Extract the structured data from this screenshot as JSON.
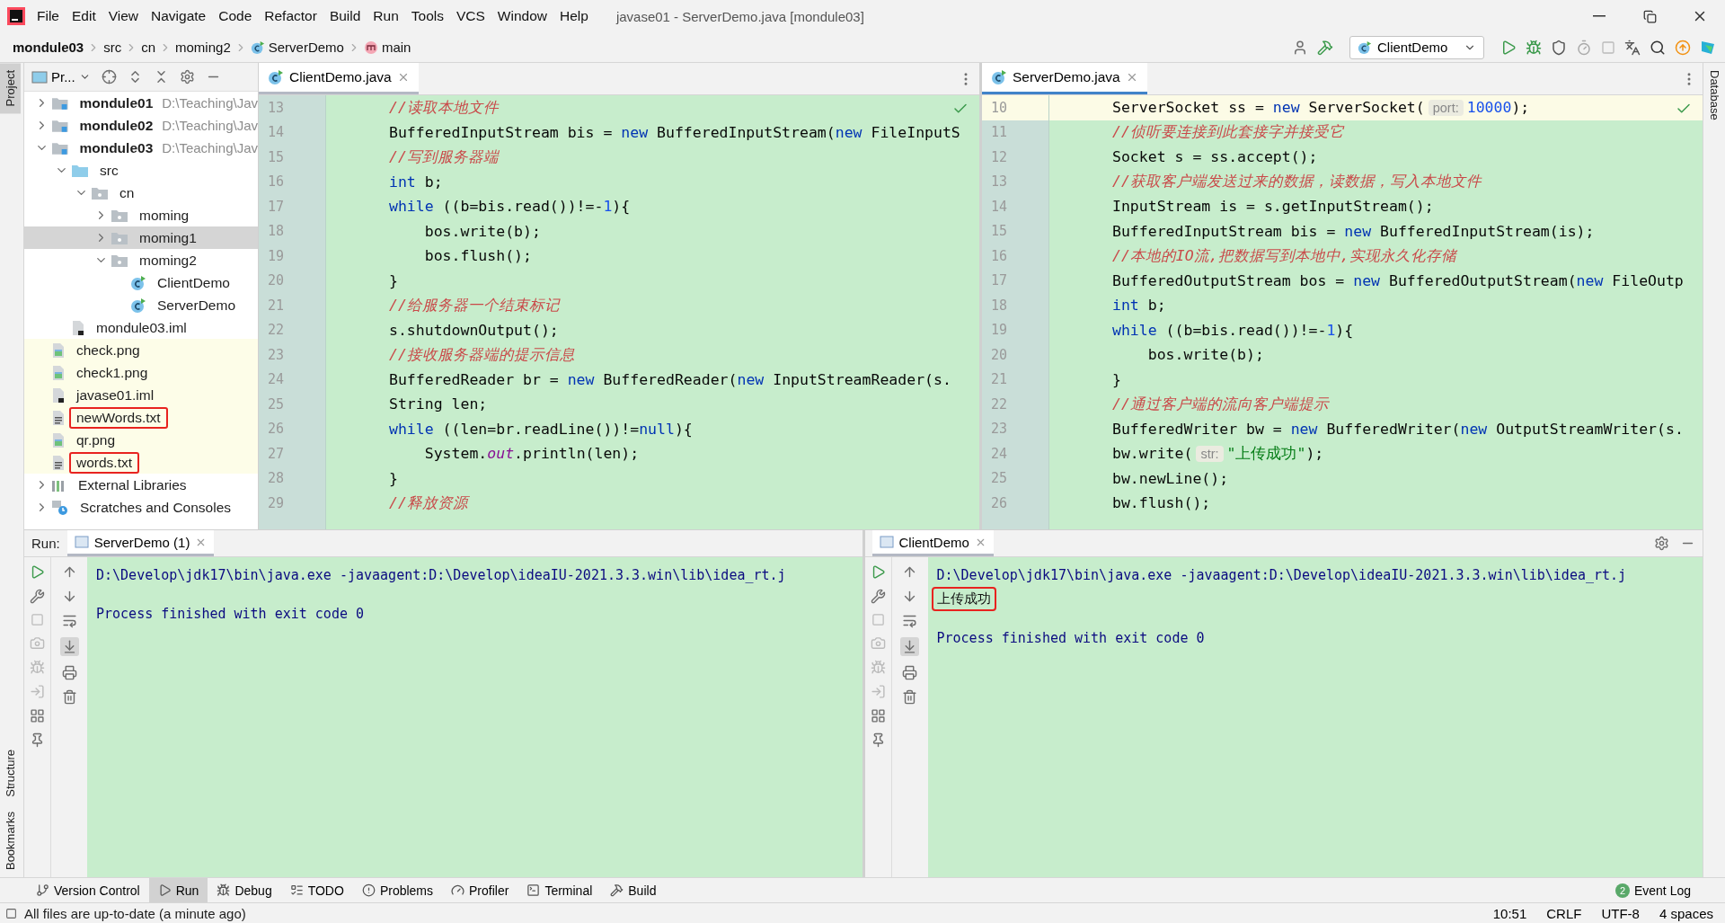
{
  "window": {
    "title": "javase01 - ServerDemo.java [mondule03]"
  },
  "menu": [
    "File",
    "Edit",
    "View",
    "Navigate",
    "Code",
    "Refactor",
    "Build",
    "Run",
    "Tools",
    "VCS",
    "Window",
    "Help"
  ],
  "breadcrumb": [
    {
      "label": "mondule03",
      "kind": "module"
    },
    {
      "label": "src",
      "kind": "plain"
    },
    {
      "label": "cn",
      "kind": "plain"
    },
    {
      "label": "moming2",
      "kind": "plain"
    },
    {
      "label": "ServerDemo",
      "kind": "class"
    },
    {
      "label": "main",
      "kind": "method"
    }
  ],
  "run_config": {
    "label": "ClientDemo"
  },
  "left_strip": {
    "top": [
      {
        "label": "Project",
        "selected": true
      }
    ],
    "bottom": [
      {
        "label": "Structure",
        "selected": false
      },
      {
        "label": "Bookmarks",
        "selected": false
      }
    ]
  },
  "right_strip": [
    {
      "label": "Database",
      "selected": false
    }
  ],
  "project": {
    "title": "Pr...",
    "tree": [
      {
        "label": "mondule01",
        "kind": "module",
        "path": "D:\\Teaching\\Jav",
        "expanded": false,
        "selected": false,
        "highlighted": false,
        "marked": false
      },
      {
        "label": "mondule02",
        "kind": "module",
        "path": "D:\\Teaching\\Jav",
        "expanded": false,
        "selected": false,
        "highlighted": false,
        "marked": false
      },
      {
        "label": "mondule03",
        "kind": "module",
        "path": "D:\\Teaching\\Jav",
        "expanded": true,
        "selected": false,
        "highlighted": false,
        "marked": false,
        "children": [
          {
            "label": "src",
            "kind": "source",
            "expanded": true,
            "selected": false,
            "highlighted": false,
            "marked": false,
            "children": [
              {
                "label": "cn",
                "kind": "package",
                "expanded": true,
                "selected": false,
                "highlighted": false,
                "marked": false,
                "children": [
                  {
                    "label": "moming",
                    "kind": "package",
                    "expanded": false,
                    "selected": false,
                    "highlighted": false,
                    "marked": false
                  },
                  {
                    "label": "moming1",
                    "kind": "package",
                    "expanded": false,
                    "selected": true,
                    "highlighted": false,
                    "marked": false
                  },
                  {
                    "label": "moming2",
                    "kind": "package",
                    "expanded": true,
                    "selected": false,
                    "highlighted": false,
                    "marked": false,
                    "children": [
                      {
                        "label": "ClientDemo",
                        "kind": "class",
                        "selected": false,
                        "highlighted": false,
                        "marked": false
                      },
                      {
                        "label": "ServerDemo",
                        "kind": "class",
                        "selected": false,
                        "highlighted": false,
                        "marked": false
                      }
                    ]
                  }
                ]
              }
            ]
          },
          {
            "label": "mondule03.iml",
            "kind": "iml",
            "selected": false,
            "highlighted": false,
            "marked": false
          }
        ]
      },
      {
        "label": "check.png",
        "kind": "image",
        "selected": false,
        "highlighted": true,
        "marked": false
      },
      {
        "label": "check1.png",
        "kind": "image",
        "selected": false,
        "highlighted": true,
        "marked": false
      },
      {
        "label": "javase01.iml",
        "kind": "iml",
        "selected": false,
        "highlighted": true,
        "marked": false
      },
      {
        "label": "newWords.txt",
        "kind": "text",
        "selected": false,
        "highlighted": true,
        "marked": true
      },
      {
        "label": "qr.png",
        "kind": "image",
        "selected": false,
        "highlighted": true,
        "marked": false
      },
      {
        "label": "words.txt",
        "kind": "text",
        "selected": false,
        "highlighted": true,
        "marked": true
      },
      {
        "label": "External Libraries",
        "kind": "library",
        "expanded": false,
        "selected": false,
        "highlighted": false,
        "marked": false
      },
      {
        "label": "Scratches and Consoles",
        "kind": "scratches",
        "expanded": false,
        "selected": false,
        "highlighted": false,
        "marked": false
      }
    ]
  },
  "editors": [
    {
      "tab": "ClientDemo.java",
      "selected": false,
      "lines": [
        {
          "n": "13",
          "current": false,
          "tokens": [
            {
              "t": "//读取本地文件",
              "kind": "comment"
            }
          ]
        },
        {
          "n": "14",
          "current": false,
          "tokens": [
            {
              "t": "BufferedInputStream bis = ",
              "kind": "plain"
            },
            {
              "t": "new",
              "kind": "keyword"
            },
            {
              "t": " BufferedInputStream(",
              "kind": "plain"
            },
            {
              "t": "new",
              "kind": "keyword"
            },
            {
              "t": " FileInputS",
              "kind": "plain"
            }
          ]
        },
        {
          "n": "15",
          "current": false,
          "tokens": [
            {
              "t": "//写到服务器端",
              "kind": "comment"
            }
          ]
        },
        {
          "n": "16",
          "current": false,
          "tokens": [
            {
              "t": "int",
              "kind": "keyword"
            },
            {
              "t": " b;",
              "kind": "plain"
            }
          ]
        },
        {
          "n": "17",
          "current": false,
          "tokens": [
            {
              "t": "while",
              "kind": "keyword"
            },
            {
              "t": " ((b=bis.read())!=-",
              "kind": "plain"
            },
            {
              "t": "1",
              "kind": "number"
            },
            {
              "t": "){",
              "kind": "plain"
            }
          ]
        },
        {
          "n": "18",
          "current": false,
          "tokens": [
            {
              "t": "    bos.write(b);",
              "kind": "plain"
            }
          ]
        },
        {
          "n": "19",
          "current": false,
          "tokens": [
            {
              "t": "    bos.flush();",
              "kind": "plain"
            }
          ]
        },
        {
          "n": "20",
          "current": false,
          "tokens": [
            {
              "t": "}",
              "kind": "plain"
            }
          ]
        },
        {
          "n": "21",
          "current": false,
          "tokens": [
            {
              "t": "//给服务器一个结束标记",
              "kind": "comment"
            }
          ]
        },
        {
          "n": "22",
          "current": false,
          "tokens": [
            {
              "t": "s.shutdownOutput();",
              "kind": "plain"
            }
          ]
        },
        {
          "n": "23",
          "current": false,
          "tokens": [
            {
              "t": "//接收服务器端的提示信息",
              "kind": "comment"
            }
          ]
        },
        {
          "n": "24",
          "current": false,
          "tokens": [
            {
              "t": "BufferedReader br = ",
              "kind": "plain"
            },
            {
              "t": "new",
              "kind": "keyword"
            },
            {
              "t": " BufferedReader(",
              "kind": "plain"
            },
            {
              "t": "new",
              "kind": "keyword"
            },
            {
              "t": " InputStreamReader(s.",
              "kind": "plain"
            }
          ]
        },
        {
          "n": "25",
          "current": false,
          "tokens": [
            {
              "t": "String len;",
              "kind": "plain"
            }
          ]
        },
        {
          "n": "26",
          "current": false,
          "tokens": [
            {
              "t": "while",
              "kind": "keyword"
            },
            {
              "t": " ((len=br.readLine())!=",
              "kind": "plain"
            },
            {
              "t": "null",
              "kind": "keyword"
            },
            {
              "t": "){",
              "kind": "plain"
            }
          ]
        },
        {
          "n": "27",
          "current": false,
          "tokens": [
            {
              "t": "    System.",
              "kind": "plain"
            },
            {
              "t": "out",
              "kind": "field"
            },
            {
              "t": ".println(len);",
              "kind": "plain"
            }
          ]
        },
        {
          "n": "28",
          "current": false,
          "tokens": [
            {
              "t": "}",
              "kind": "plain"
            }
          ]
        },
        {
          "n": "29",
          "current": false,
          "tokens": [
            {
              "t": "//释放资源",
              "kind": "comment"
            }
          ]
        }
      ]
    },
    {
      "tab": "ServerDemo.java",
      "selected": true,
      "lines": [
        {
          "n": "10",
          "current": true,
          "tokens": [
            {
              "t": "ServerSocket ss = ",
              "kind": "plain"
            },
            {
              "t": "new",
              "kind": "keyword"
            },
            {
              "t": " ServerSocket(",
              "kind": "plain"
            },
            {
              "t": "port:",
              "kind": "hint"
            },
            {
              "t": "10000",
              "kind": "number"
            },
            {
              "t": ");",
              "kind": "plain"
            }
          ]
        },
        {
          "n": "11",
          "current": false,
          "tokens": [
            {
              "t": "//侦听要连接到此套接字并接受它",
              "kind": "comment"
            }
          ]
        },
        {
          "n": "12",
          "current": false,
          "tokens": [
            {
              "t": "Socket s = ss.accept();",
              "kind": "plain"
            }
          ]
        },
        {
          "n": "13",
          "current": false,
          "tokens": [
            {
              "t": "//获取客户端发送过来的数据，读数据，写入本地文件",
              "kind": "comment"
            }
          ]
        },
        {
          "n": "14",
          "current": false,
          "tokens": [
            {
              "t": "InputStream is = s.getInputStream();",
              "kind": "plain"
            }
          ]
        },
        {
          "n": "15",
          "current": false,
          "tokens": [
            {
              "t": "BufferedInputStream bis = ",
              "kind": "plain"
            },
            {
              "t": "new",
              "kind": "keyword"
            },
            {
              "t": " BufferedInputStream(is);",
              "kind": "plain"
            }
          ]
        },
        {
          "n": "16",
          "current": false,
          "tokens": [
            {
              "t": "//本地的IO流,把数据写到本地中,实现永久化存储",
              "kind": "comment"
            }
          ]
        },
        {
          "n": "17",
          "current": false,
          "tokens": [
            {
              "t": "BufferedOutputStream bos = ",
              "kind": "plain"
            },
            {
              "t": "new",
              "kind": "keyword"
            },
            {
              "t": " BufferedOutputStream(",
              "kind": "plain"
            },
            {
              "t": "new",
              "kind": "keyword"
            },
            {
              "t": " FileOutp",
              "kind": "plain"
            }
          ]
        },
        {
          "n": "18",
          "current": false,
          "tokens": [
            {
              "t": "int",
              "kind": "keyword"
            },
            {
              "t": " b;",
              "kind": "plain"
            }
          ]
        },
        {
          "n": "19",
          "current": false,
          "tokens": [
            {
              "t": "while",
              "kind": "keyword"
            },
            {
              "t": " ((b=bis.read())!=-",
              "kind": "plain"
            },
            {
              "t": "1",
              "kind": "number"
            },
            {
              "t": "){",
              "kind": "plain"
            }
          ]
        },
        {
          "n": "20",
          "current": false,
          "tokens": [
            {
              "t": "    bos.write(b);",
              "kind": "plain"
            }
          ]
        },
        {
          "n": "21",
          "current": false,
          "tokens": [
            {
              "t": "}",
              "kind": "plain"
            }
          ]
        },
        {
          "n": "22",
          "current": false,
          "tokens": [
            {
              "t": "//通过客户端的流向客户端提示",
              "kind": "comment"
            }
          ]
        },
        {
          "n": "23",
          "current": false,
          "tokens": [
            {
              "t": "BufferedWriter bw = ",
              "kind": "plain"
            },
            {
              "t": "new",
              "kind": "keyword"
            },
            {
              "t": " BufferedWriter(",
              "kind": "plain"
            },
            {
              "t": "new",
              "kind": "keyword"
            },
            {
              "t": " OutputStreamWriter(s.",
              "kind": "plain"
            }
          ]
        },
        {
          "n": "24",
          "current": false,
          "tokens": [
            {
              "t": "bw.write(",
              "kind": "plain"
            },
            {
              "t": "str:",
              "kind": "hint"
            },
            {
              "t": "\"上传成功\"",
              "kind": "string"
            },
            {
              "t": ");",
              "kind": "plain"
            }
          ]
        },
        {
          "n": "25",
          "current": false,
          "tokens": [
            {
              "t": "bw.newLine();",
              "kind": "plain"
            }
          ]
        },
        {
          "n": "26",
          "current": false,
          "tokens": [
            {
              "t": "bw.flush();",
              "kind": "plain"
            }
          ]
        }
      ]
    }
  ],
  "run": {
    "label": "Run:",
    "panels": [
      {
        "tab": "ServerDemo (1)",
        "output": [
          {
            "text": "D:\\Develop\\jdk17\\bin\\java.exe -javaagent:D:\\Develop\\ideaIU-2021.3.3.win\\lib\\idea_rt.j",
            "kind": "system",
            "marked": false
          },
          {
            "text": "Process finished with exit code 0",
            "kind": "exit",
            "marked": false
          }
        ]
      },
      {
        "tab": "ClientDemo",
        "output": [
          {
            "text": "D:\\Develop\\jdk17\\bin\\java.exe -javaagent:D:\\Develop\\ideaIU-2021.3.3.win\\lib\\idea_rt.j",
            "kind": "system",
            "marked": false
          },
          {
            "text": "上传成功",
            "kind": "stdout",
            "marked": true
          },
          {
            "text": "Process finished with exit code 0",
            "kind": "exit",
            "marked": false
          }
        ]
      }
    ]
  },
  "tool_windows": [
    {
      "label": "Version Control",
      "kind": "vcs",
      "selected": false
    },
    {
      "label": "Run",
      "kind": "run",
      "selected": true
    },
    {
      "label": "Debug",
      "kind": "debug",
      "selected": false
    },
    {
      "label": "TODO",
      "kind": "todo",
      "selected": false
    },
    {
      "label": "Problems",
      "kind": "problems",
      "selected": false
    },
    {
      "label": "Profiler",
      "kind": "profiler",
      "selected": false
    },
    {
      "label": "Terminal",
      "kind": "terminal",
      "selected": false
    },
    {
      "label": "Build",
      "kind": "build",
      "selected": false
    }
  ],
  "event_log": {
    "label": "Event Log",
    "count": "2"
  },
  "status_bar": {
    "message": "All files are up-to-date (a minute ago)",
    "items": [
      "10:51",
      "CRLF",
      "UTF-8",
      "4 spaces"
    ]
  }
}
